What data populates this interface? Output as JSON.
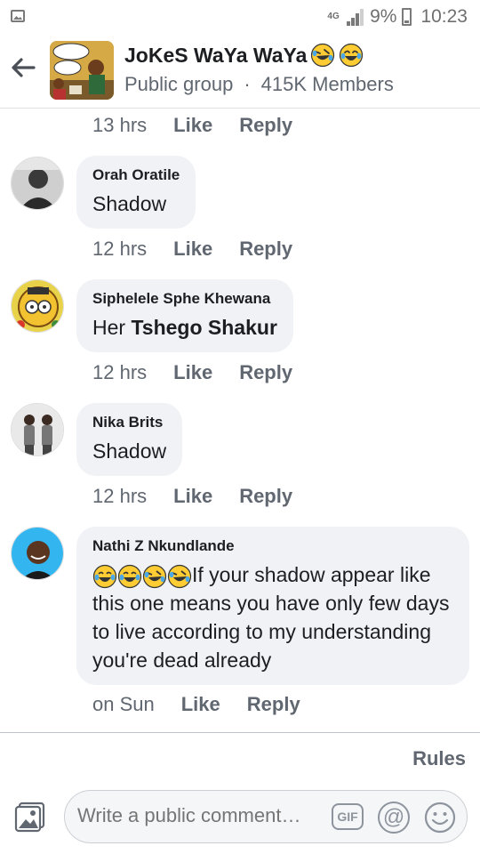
{
  "status_bar": {
    "network": "4G",
    "battery": "9%",
    "time": "10:23",
    "icons": [
      "image-icon",
      "signal-icon",
      "battery-icon"
    ]
  },
  "header": {
    "title": "JoKeS WaYa WaYa",
    "title_emojis": [
      "rolling-laughing-emoji",
      "tears-of-joy-emoji"
    ],
    "group_type": "Public group",
    "members": "415K Members"
  },
  "comments": [
    {
      "author": "",
      "text": "",
      "time": "13 hrs",
      "like": "Like",
      "reply": "Reply"
    },
    {
      "author": "Orah Oratile",
      "text": "Shadow",
      "time": "12 hrs",
      "like": "Like",
      "reply": "Reply"
    },
    {
      "author": "Siphelele Sphe Khewana",
      "text_prefix": "Her",
      "text_bold": "Tshego Shakur",
      "time": "12 hrs",
      "like": "Like",
      "reply": "Reply"
    },
    {
      "author": "Nika Brits",
      "text": "Shadow",
      "time": "12 hrs",
      "like": "Like",
      "reply": "Reply"
    },
    {
      "author": "Nathi Z Nkundlande",
      "text_emojis": [
        "tears-of-joy-emoji",
        "tears-of-joy-emoji",
        "rolling-laughing-emoji",
        "rolling-laughing-emoji"
      ],
      "text": "If your shadow appear like this one means you have only few days to live according to my understanding you're dead already",
      "time": "on Sun",
      "like": "Like",
      "reply": "Reply"
    }
  ],
  "footer": {
    "rules": "Rules",
    "composer_placeholder": "Write a public comment…",
    "gif_label": "GIF",
    "at_label": "@"
  },
  "colors": {
    "bubble": "#f0f2f5",
    "meta": "#606770",
    "text": "#1c1e21",
    "divider": "#dddfe2"
  }
}
